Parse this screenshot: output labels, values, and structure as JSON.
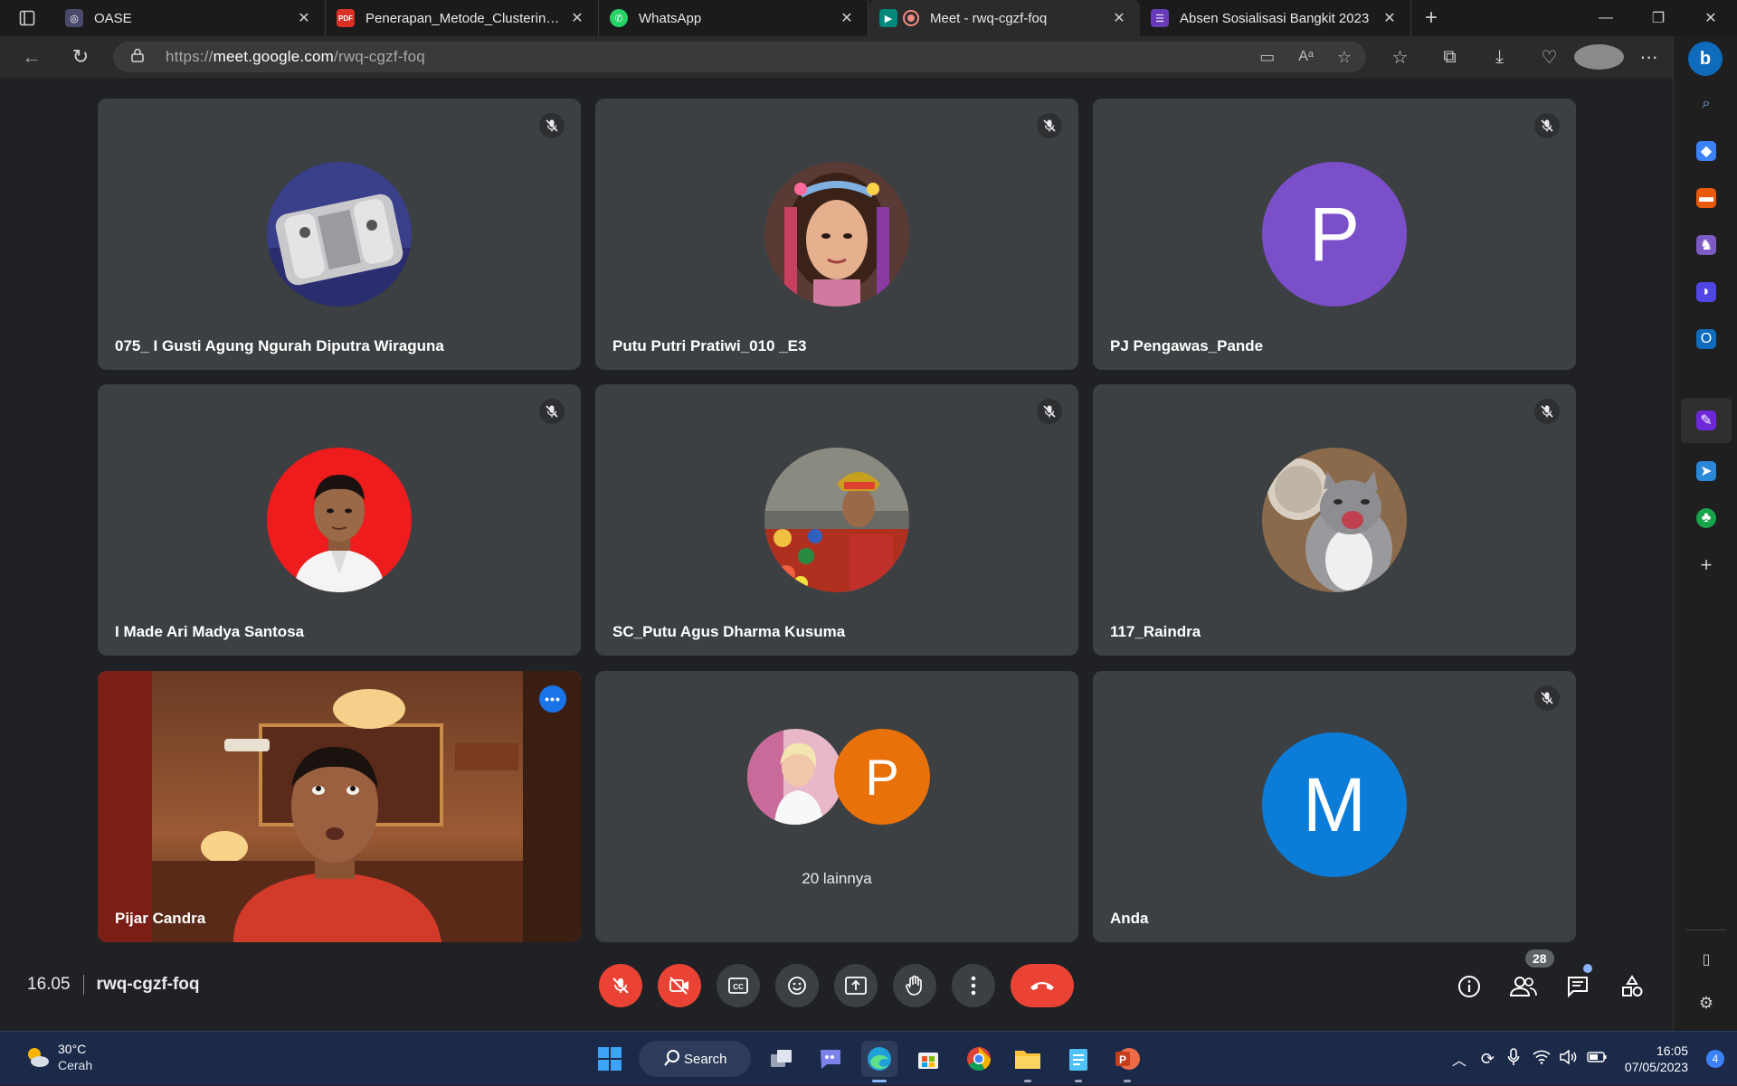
{
  "browser": {
    "tabs": [
      {
        "title": "OASE",
        "color": "#4a4a6a",
        "icon": "oase-icon"
      },
      {
        "title": "Penerapan_Metode_Clustering_Te",
        "color": "#d93025",
        "icon": "pdf-icon"
      },
      {
        "title": "WhatsApp",
        "color": "#25d366",
        "icon": "whatsapp-icon"
      },
      {
        "title": "Meet - rwq-cgzf-foq",
        "color": "#00897b",
        "icon": "meet-icon"
      },
      {
        "title": "Absen Sosialisasi Bangkit 2023",
        "color": "#673ab7",
        "icon": "forms-icon"
      }
    ],
    "url_scheme": "https://",
    "url_host": "meet.google.com",
    "url_path": "/rwq-cgzf-foq"
  },
  "meet": {
    "tiles": [
      {
        "name": "075_ I Gusti Agung Ngurah Diputra Wiraguna",
        "avatar": "photo",
        "muted": true
      },
      {
        "name": "Putu Putri Pratiwi_010 _E3",
        "avatar": "photo",
        "muted": true
      },
      {
        "name": "PJ Pengawas_Pande",
        "avatar": "P",
        "avatar_color": "#7b4fc9",
        "muted": true
      },
      {
        "name": "I Made Ari Madya Santosa",
        "avatar": "photo",
        "muted": true
      },
      {
        "name": "SC_Putu Agus Dharma Kusuma",
        "avatar": "photo",
        "muted": true
      },
      {
        "name": "117_Raindra",
        "avatar": "photo",
        "muted": true
      },
      {
        "name": "Pijar Candra",
        "avatar": "video",
        "muted": false
      },
      {
        "others_label": "20 lainnya",
        "avatar": "P",
        "avatar_color": "#e8710a"
      },
      {
        "name": "Anda",
        "avatar": "M",
        "avatar_color": "#0b7dd8",
        "muted": true
      }
    ],
    "time": "16.05",
    "code": "rwq-cgzf-foq",
    "participants_count": "28"
  },
  "taskbar": {
    "temperature": "30°C",
    "condition": "Cerah",
    "search_label": "Search",
    "clock_time": "16:05",
    "clock_date": "07/05/2023",
    "notifications": "4"
  }
}
